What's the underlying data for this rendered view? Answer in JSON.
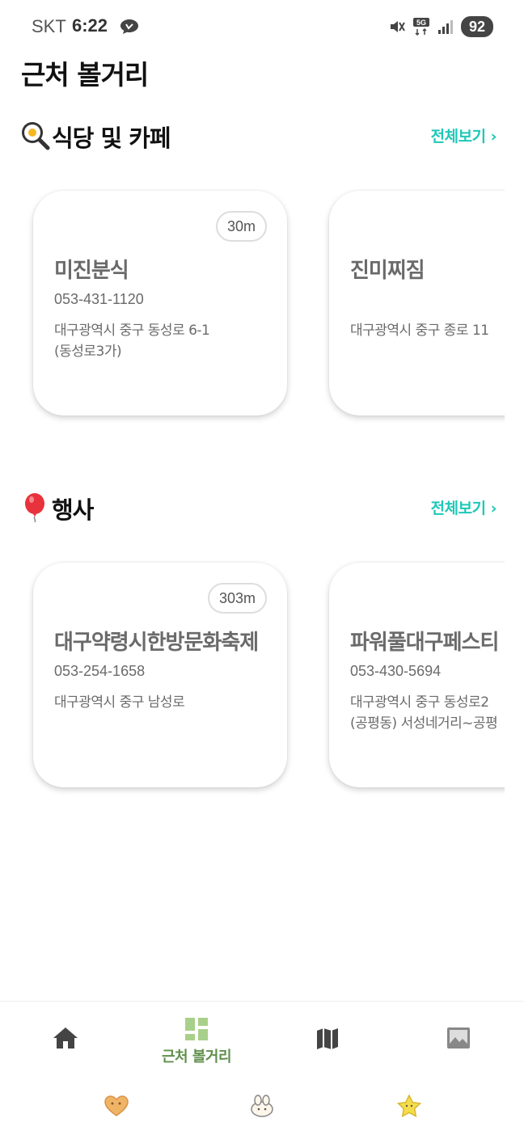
{
  "status_bar": {
    "carrier": "SKT",
    "time": "6:22",
    "network": "5G",
    "battery": "92"
  },
  "header": {
    "title": "근처 볼거리"
  },
  "sections": [
    {
      "title": "식당 및 카페",
      "emoji_icon": "frying-pan-egg-icon",
      "see_all": "전체보기 ›",
      "cards": [
        {
          "distance": "30m",
          "name": "미진분식",
          "phone": "053-431-1120",
          "address": "대구광역시 중구 동성로 6-1\n(동성로3가)"
        },
        {
          "distance": "",
          "name": "진미찌짐",
          "phone": "",
          "address": "대구광역시 중구 종로 11"
        }
      ]
    },
    {
      "title": "행사",
      "emoji_icon": "balloon-icon",
      "see_all": "전체보기 ›",
      "cards": [
        {
          "distance": "303m",
          "name": "대구약령시한방문화축제",
          "phone": "053-254-1658",
          "address": "대구광역시 중구 남성로"
        },
        {
          "distance": "",
          "name": "파워풀대구페스티",
          "phone": "053-430-5694",
          "address": "대구광역시 중구 동성로2\n(공평동) 서성네거리~공평"
        }
      ]
    }
  ],
  "bottom_nav": {
    "items": [
      {
        "icon": "home-icon",
        "label": ""
      },
      {
        "icon": "dashboard-icon",
        "label": "근처 볼거리"
      },
      {
        "icon": "map-icon",
        "label": ""
      },
      {
        "icon": "image-icon",
        "label": ""
      }
    ],
    "sub_icons": [
      "heart-cookie-icon",
      "bunny-icon",
      "star-icon"
    ]
  },
  "colors": {
    "accent": "#1fc8b8",
    "nav_active": "#5f8f4c",
    "nav_active_icon": "#a8d08a",
    "text_muted": "#6a6a6a"
  }
}
